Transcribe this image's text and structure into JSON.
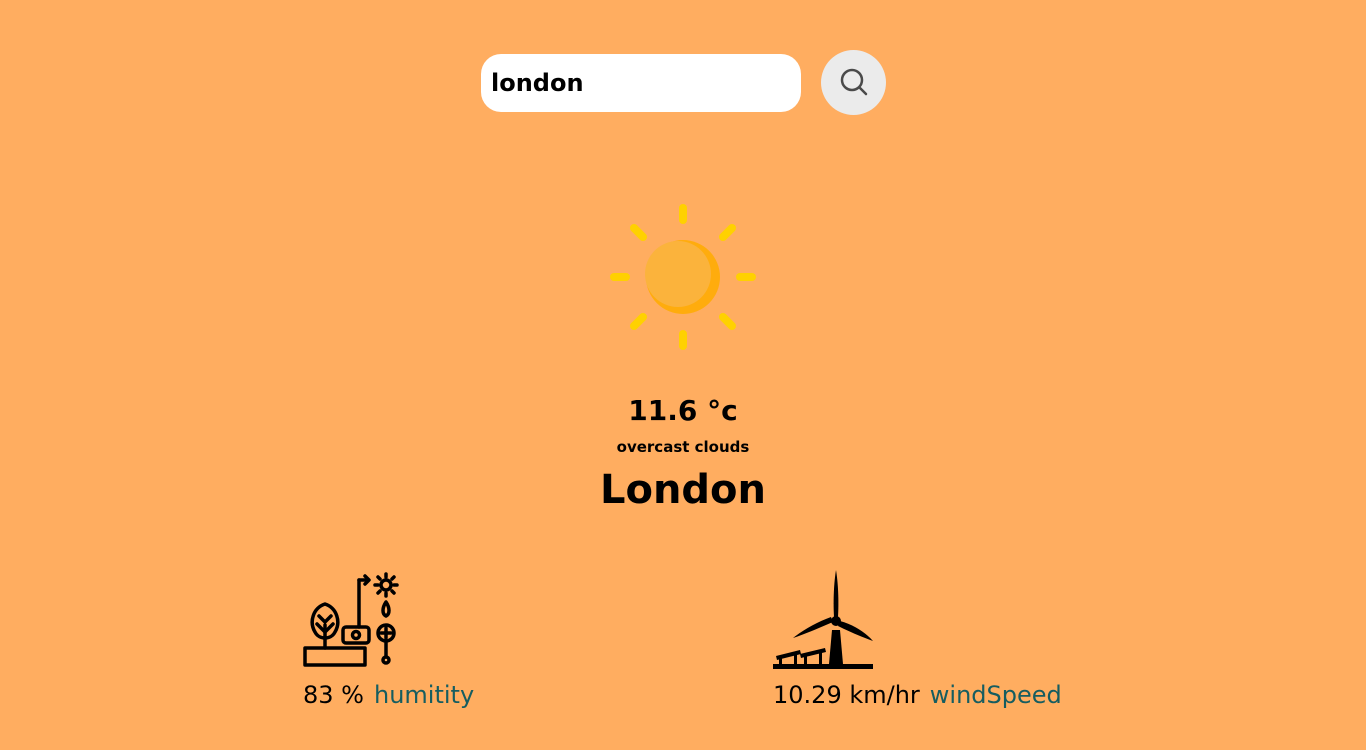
{
  "search": {
    "value": "london",
    "button_icon": "search-icon"
  },
  "weather": {
    "icon": "sun-icon",
    "temperature": "11.6 °c",
    "condition": "overcast clouds",
    "city": "London"
  },
  "stats": {
    "humidity": {
      "icon": "humidity-plant-icon",
      "value": "83 %",
      "label": "humitity"
    },
    "wind": {
      "icon": "wind-turbine-icon",
      "value": "10.29 km/hr",
      "label": "windSpeed"
    }
  },
  "colors": {
    "background": "#FFAD60",
    "label_accent": "#165D60",
    "sun_rays": "#FFD100",
    "sun_body": "#FBB33C"
  }
}
